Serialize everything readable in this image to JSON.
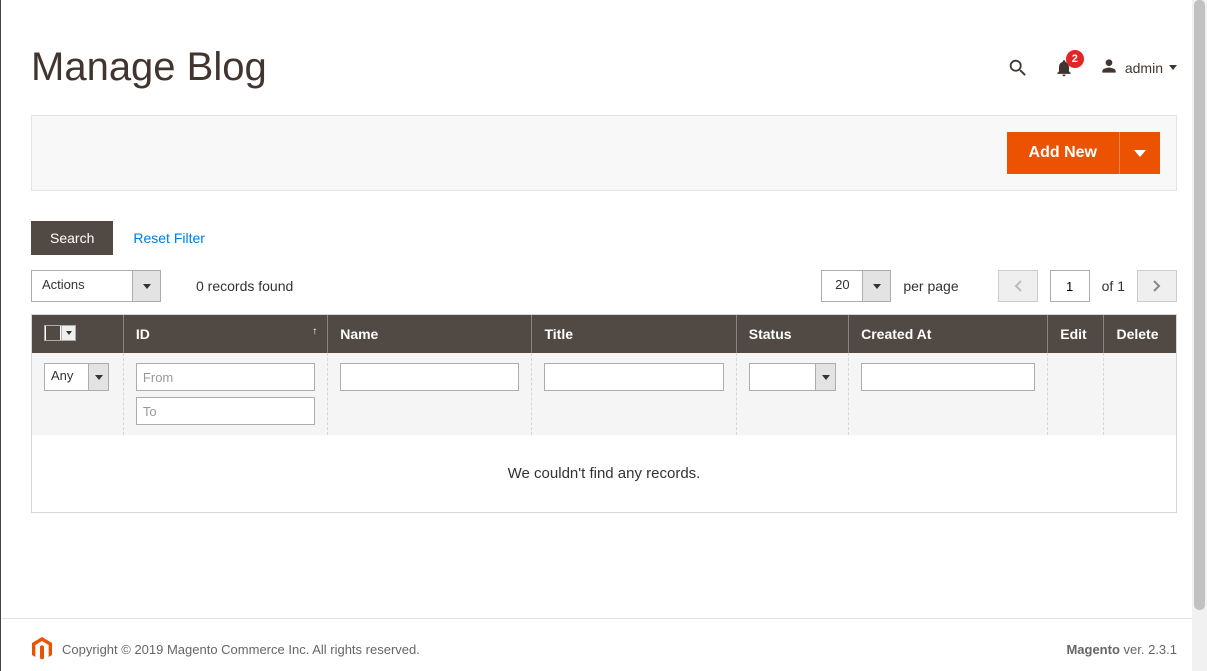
{
  "header": {
    "title": "Manage Blog",
    "notification_count": "2",
    "username": "admin"
  },
  "toolbar": {
    "add_new_label": "Add New",
    "search_label": "Search",
    "reset_filter_label": "Reset Filter",
    "actions_label": "Actions",
    "records_found": "0 records found",
    "per_page_value": "20",
    "per_page_label": "per page",
    "current_page": "1",
    "of_label": "of",
    "total_pages": "1"
  },
  "grid": {
    "columns": {
      "id": "ID",
      "name": "Name",
      "title": "Title",
      "status": "Status",
      "created_at": "Created At",
      "edit": "Edit",
      "delete": "Delete"
    },
    "filters": {
      "any_label": "Any",
      "from_placeholder": "From",
      "to_placeholder": "To"
    },
    "empty_message": "We couldn't find any records."
  },
  "footer": {
    "copyright": "Copyright © 2019 Magento Commerce Inc. All rights reserved.",
    "brand": "Magento",
    "version_label": " ver. 2.3.1"
  }
}
